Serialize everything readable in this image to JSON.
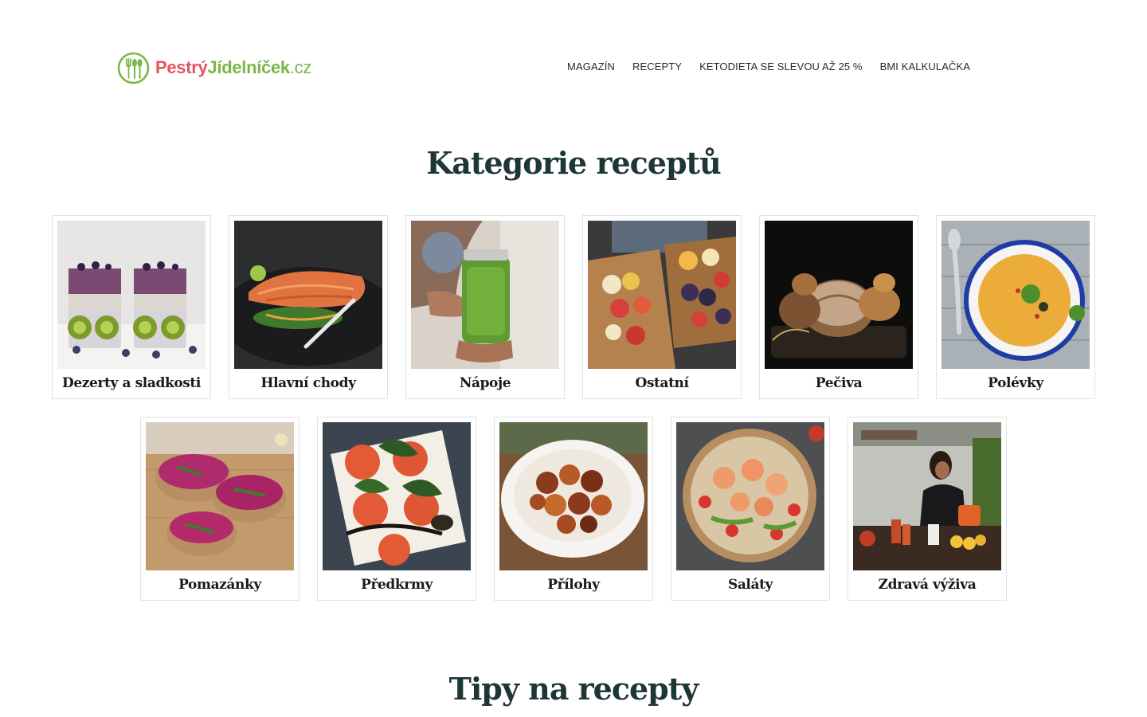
{
  "header": {
    "logo": {
      "part1": "Pestrý",
      "part2": "Jídelníček",
      "part3": ".cz"
    },
    "nav": [
      {
        "label": "MAGAZÍN"
      },
      {
        "label": "RECEPTY"
      },
      {
        "label": "KETODIETA SE SLEVOU AŽ 25 %"
      },
      {
        "label": "BMI KALKULAČKA"
      }
    ]
  },
  "categories_section": {
    "title": "Kategorie receptů",
    "items": [
      {
        "label": "Dezerty a sladkosti",
        "image": "chia-kiwi-dessert-photo"
      },
      {
        "label": "Hlavní chody",
        "image": "salmon-dish-photo"
      },
      {
        "label": "Nápoje",
        "image": "green-smoothie-jar-photo"
      },
      {
        "label": "Ostatní",
        "image": "fruit-platter-photo"
      },
      {
        "label": "Pečiva",
        "image": "bread-basket-photo"
      },
      {
        "label": "Polévky",
        "image": "orange-soup-bowl-photo"
      },
      {
        "label": "Pomazánky",
        "image": "beet-spread-toast-photo"
      },
      {
        "label": "Předkrmy",
        "image": "caprese-tomato-photo"
      },
      {
        "label": "Přílohy",
        "image": "roasted-potatoes-bowl-photo"
      },
      {
        "label": "Saláty",
        "image": "shrimp-salad-bowl-photo"
      },
      {
        "label": "Zdravá výživa",
        "image": "woman-kitchen-photo"
      }
    ]
  },
  "tips_section": {
    "title": "Tipy na recepty"
  },
  "colors": {
    "brand_red": "#e5555f",
    "brand_green": "#7ab648",
    "title_dark": "#1d3636",
    "nav_text": "#1f2a2e"
  }
}
